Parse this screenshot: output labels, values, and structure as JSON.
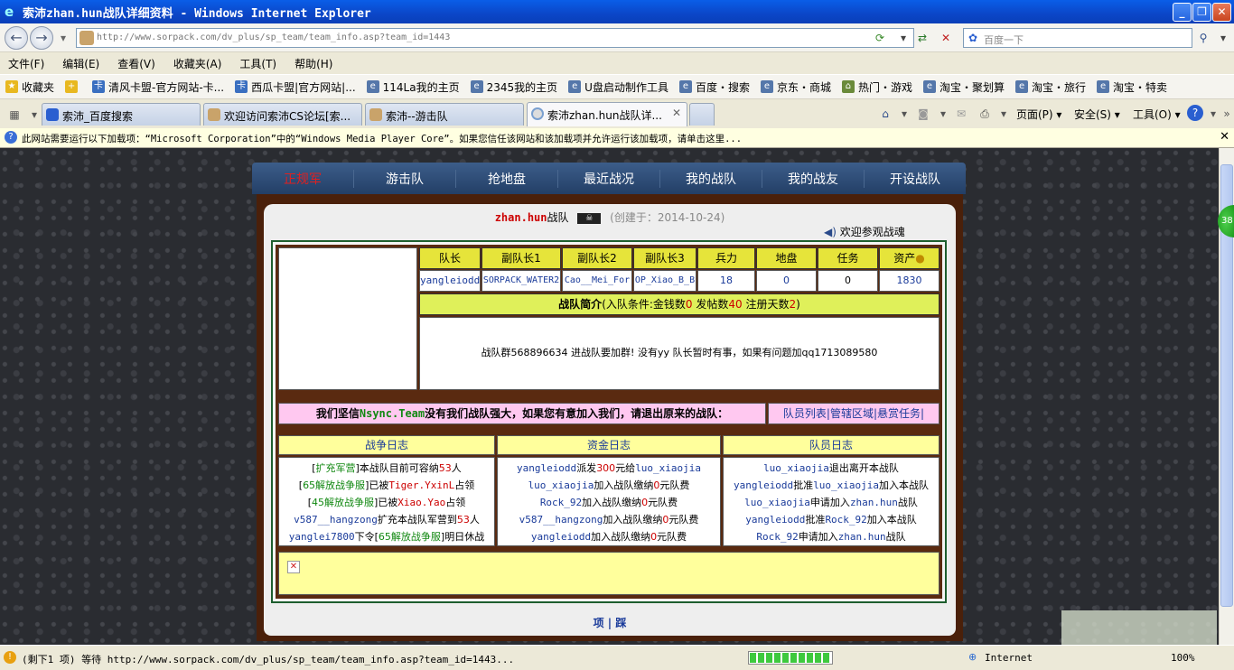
{
  "window": {
    "title": "索沛zhan.hun战队详细资料 - Windows Internet Explorer"
  },
  "address": {
    "url": "http://www.sorpack.com/dv_plus/sp_team/team_info.asp?team_id=1443",
    "search_placeholder": "百度一下"
  },
  "menu": [
    "文件(F)",
    "编辑(E)",
    "查看(V)",
    "收藏夹(A)",
    "工具(T)",
    "帮助(H)"
  ],
  "favorites": {
    "label": "收藏夹",
    "items": [
      "清风卡盟-官方网站-卡...",
      "西瓜卡盟|官方网站|...",
      "114La我的主页",
      "2345我的主页",
      "U盘启动制作工具",
      "百度・搜索",
      "京东・商城",
      "热门・游戏",
      "淘宝・聚划算",
      "淘宝・旅行",
      "淘宝・特卖"
    ]
  },
  "tabs": [
    "索沛_百度搜索",
    "欢迎访问索沛CS论坛[索...",
    "索沛--游击队",
    "索沛zhan.hun战队详..."
  ],
  "commandbar": {
    "page": "页面(P)",
    "safety": "安全(S)",
    "tools": "工具(O)"
  },
  "infobar": "此网站需要运行以下加载项：“Microsoft Corporation”中的“Windows Media Player Core”。如果您信任该网站和该加载项并允许运行该加载项，请单击这里...",
  "game": {
    "nav": [
      "正规军",
      "游击队",
      "抢地盘",
      "最近战况",
      "我的战队",
      "我的战友",
      "开设战队"
    ],
    "team_name": "zhan.hun",
    "team_suffix": "战队",
    "created": "(创建于：2014-10-24)",
    "welcome": "欢迎参观战魂",
    "stats_headers": [
      "队长",
      "副队长1",
      "副队长2",
      "副队长3",
      "兵力",
      "地盘",
      "任务",
      "资产"
    ],
    "stats_values": [
      "yangleiodd",
      "SORPACK_WATER2",
      "Cao__Mei_For",
      "OP_Xiao_B_B",
      "18",
      "0",
      "0",
      "1830"
    ],
    "intro_title": "战队简介",
    "intro_pre": "(入队条件:金钱数",
    "intro_money": "0",
    "intro_mid": " 发帖数",
    "intro_posts": "40",
    "intro_mid2": " 注册天数",
    "intro_days": "2",
    "intro_end": ")",
    "intro_text": "战队群568896634 进战队要加群! 没有yy 队长暂时有事，如果有问题加qq1713089580",
    "slogan_pre": "我们坚信",
    "slogan_team": "Nsync.Team",
    "slogan_post": "没有我们战队强大，如果您有意加入我们，请退出原来的战队：",
    "links": [
      "队员列表",
      "管辖区域",
      "悬赏任务"
    ],
    "logs": {
      "war_title": "战争日志",
      "fund_title": "资金日志",
      "member_title": "队员日志"
    },
    "bottom": [
      "项",
      "踩"
    ]
  },
  "status": {
    "text": "(剩下1 项) 等待 http://www.sorpack.com/dv_plus/sp_team/team_info.asp?team_id=1443...",
    "zone": "Internet",
    "zoom": "100%"
  }
}
